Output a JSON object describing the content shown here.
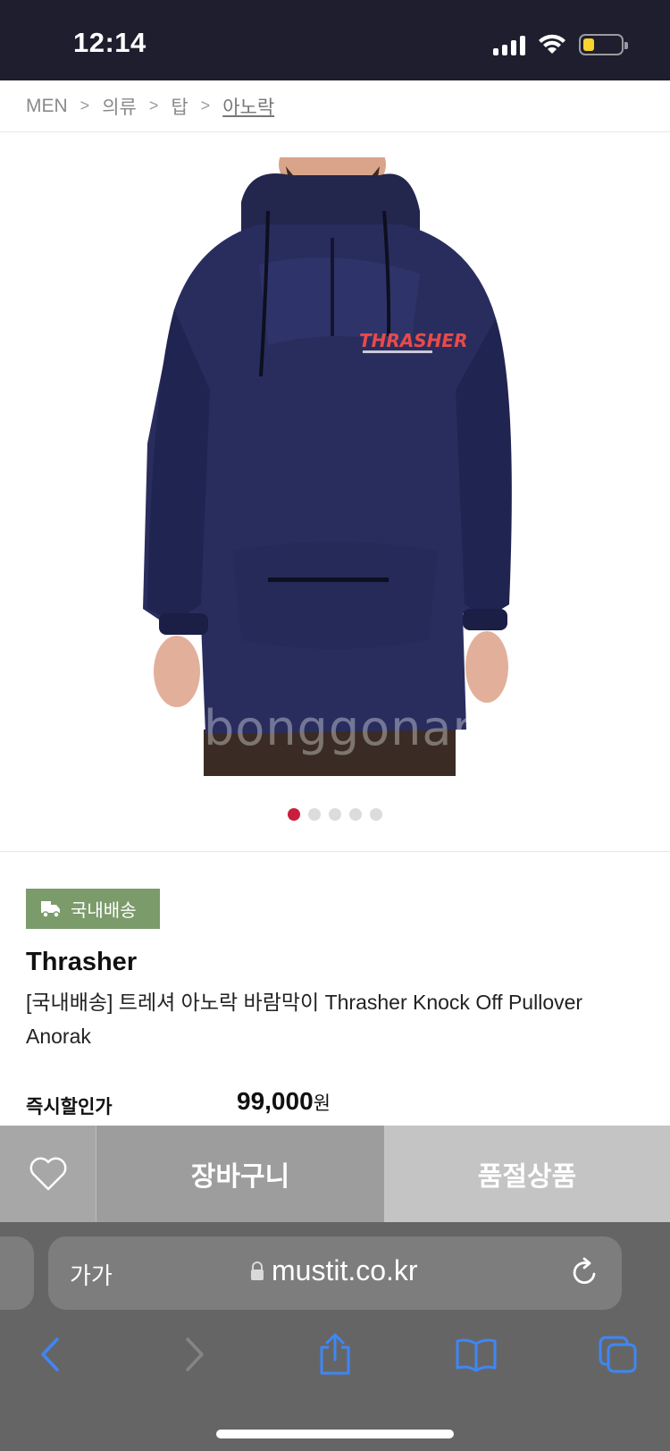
{
  "status_bar": {
    "time": "12:14"
  },
  "breadcrumb": {
    "items": [
      "MEN",
      "의류",
      "탑"
    ],
    "current": "아노락",
    "separator": ">"
  },
  "gallery": {
    "watermark": "bonggonara",
    "logo_text": "THRASHER",
    "page_count": 5,
    "active_index": 0
  },
  "product": {
    "badge": "국내배송",
    "brand": "Thrasher",
    "title": "[국내배송] 트레셔 아노락 바람막이 Thrasher Knock Off Pullover Anorak",
    "price_label": "즉시할인가",
    "price": "99,000",
    "price_unit": "원"
  },
  "actions": {
    "cart_label": "장바구니",
    "soldout_label": "품절상품"
  },
  "browser": {
    "text_size_label": "가가",
    "url": "mustit.co.kr"
  },
  "colors": {
    "status_bar_bg": "#1f1e2e",
    "badge_bg": "#7b9b6b",
    "dot_active": "#c81e3c",
    "browser_icon": "#3d87f5"
  }
}
